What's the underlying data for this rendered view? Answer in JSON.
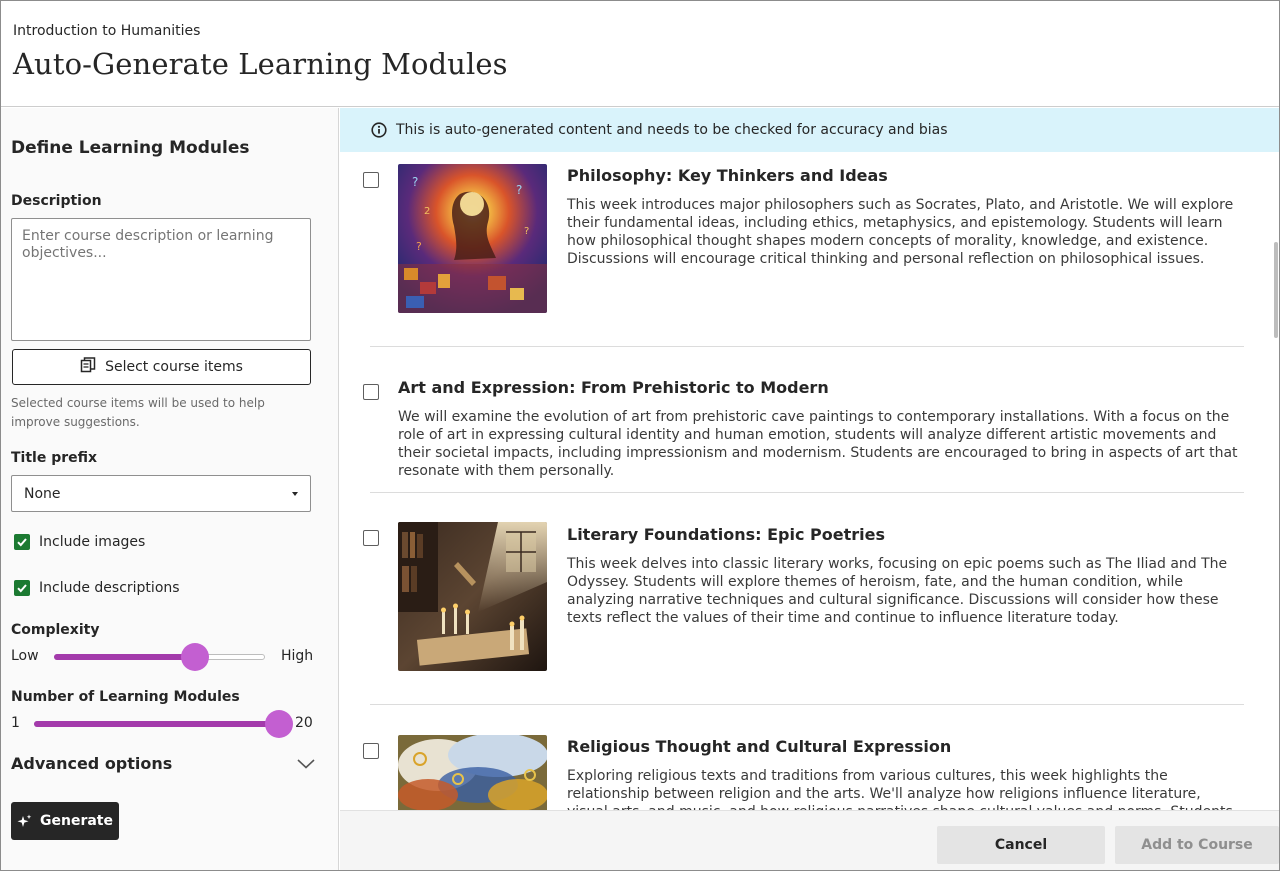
{
  "header": {
    "breadcrumb": "Introduction to Humanities",
    "title": "Auto-Generate Learning Modules"
  },
  "sidebar": {
    "heading": "Define Learning Modules",
    "description_label": "Description",
    "description_placeholder": "Enter course description or learning objectives...",
    "select_items_label": "Select course items",
    "helper_text": "Selected course items will be used to help improve suggestions.",
    "title_prefix_label": "Title prefix",
    "title_prefix_value": "None",
    "include_images_label": "Include images",
    "include_images_checked": true,
    "include_descriptions_label": "Include descriptions",
    "include_descriptions_checked": true,
    "complexity_label": "Complexity",
    "complexity_min_label": "Low",
    "complexity_max_label": "High",
    "complexity_value": 0.67,
    "modules_label": "Number of Learning Modules",
    "modules_min": "1",
    "modules_max": "20",
    "modules_value": 20,
    "advanced_label": "Advanced options",
    "generate_label": "Generate",
    "accent_color": "#a33aab",
    "check_color": "#1c7a32"
  },
  "notice": {
    "icon": "info-icon",
    "text": "This is auto-generated content and needs to be checked for accuracy and bias",
    "background": "#d9f3fb"
  },
  "modules": [
    {
      "title": "Philosophy: Key Thinkers and Ideas",
      "description": "This week introduces major philosophers such as Socrates, Plato, and Aristotle. We will explore their fundamental ideas, including ethics, metaphysics, and epistemology. Students will learn how philosophical thought shapes modern concepts of morality, knowledge, and existence. Discussions will encourage critical thinking and personal reflection on philosophical issues.",
      "has_image": true
    },
    {
      "title": "Art and Expression: From Prehistoric to Modern",
      "description": "We will examine the evolution of art from prehistoric cave paintings to contemporary installations. With a focus on the role of art in expressing cultural identity and human emotion, students will analyze different artistic movements and their societal impacts, including impressionism and modernism. Students are encouraged to bring in aspects of art that resonate with them personally.",
      "has_image": false
    },
    {
      "title": "Literary Foundations: Epic Poetries",
      "description": "This week delves into classic literary works, focusing on epic poems such as The Iliad and The Odyssey. Students will explore themes of heroism, fate, and the human condition, while analyzing narrative techniques and cultural significance. Discussions will consider how these texts reflect the values of their time and continue to influence literature today.",
      "has_image": true
    },
    {
      "title": "Religious Thought and Cultural Expression",
      "description": "Exploring religious texts and traditions from various cultures, this week highlights the relationship between religion and the arts. We'll analyze how religions influence literature, visual arts, and music, and how religious narratives shape cultural values and norms. Students will engage in discussions.",
      "has_image": true
    }
  ],
  "footer": {
    "cancel_label": "Cancel",
    "add_label": "Add to Course"
  }
}
